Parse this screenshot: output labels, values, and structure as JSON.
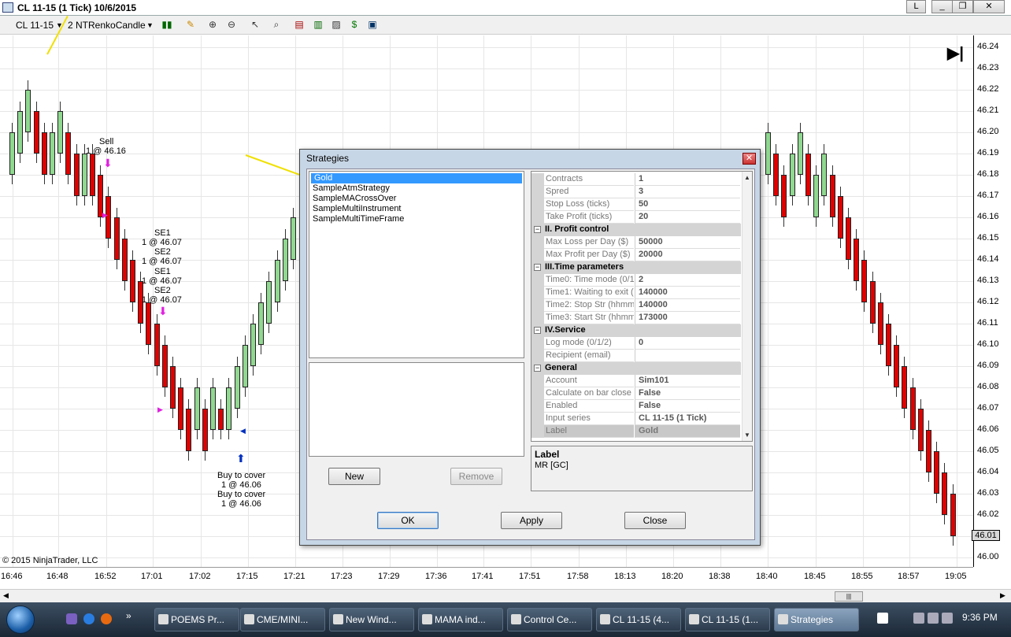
{
  "window": {
    "title": "CL 11-15 (1 Tick)  10/6/2015",
    "controls": [
      "L",
      "_",
      "❐",
      "✕"
    ]
  },
  "toolbar": {
    "instrument": "CL 11-15",
    "bar_type": "2 NTRenkoCandle"
  },
  "chart": {
    "price_ticks": [
      "46.24",
      "46.23",
      "46.22",
      "46.21",
      "46.20",
      "46.19",
      "46.18",
      "46.17",
      "46.16",
      "46.15",
      "46.14",
      "46.13",
      "46.12",
      "46.11",
      "46.10",
      "46.09",
      "46.08",
      "46.07",
      "46.06",
      "46.05",
      "46.04",
      "46.03",
      "46.02",
      "46.01",
      "46.00"
    ],
    "last_price": "46.01",
    "time_ticks": [
      "16:46",
      "16:48",
      "16:52",
      "17:01",
      "17:02",
      "17:15",
      "17:21",
      "17:23",
      "17:29",
      "17:36",
      "17:41",
      "17:51",
      "17:58",
      "18:13",
      "18:20",
      "18:38",
      "18:40",
      "18:45",
      "18:55",
      "18:57",
      "19:05"
    ],
    "copyright": "© 2015 NinjaTrader, LLC",
    "up_color": "#90d890",
    "down_color": "#e00000",
    "annotations": {
      "sell_1": "Sell",
      "sell_2": "1 @ 46.16",
      "se1_a": "SE1",
      "se1_a_qty": "1 @ 46.07",
      "se2_a": "SE2",
      "se2_a_qty": "1 @ 46.07",
      "se1_b": "SE1",
      "se1_b_qty": "1 @ 46.07",
      "se2_b": "SE2",
      "se2_b_qty": "1 @ 46.07",
      "btc_1": "Buy to cover",
      "btc_1_qty": "1 @ 46.06",
      "btc_2": "Buy to cover",
      "btc_2_qty": "1 @ 46.06"
    }
  },
  "dialog": {
    "title": "Strategies",
    "strategies": [
      "Gold",
      "SampleAtmStrategy",
      "SampleMACrossOver",
      "SampleMultiInstrument",
      "SampleMultiTimeFrame"
    ],
    "selected_strategy": "Gold",
    "buttons": {
      "new": "New",
      "remove": "Remove",
      "ok": "OK",
      "apply": "Apply",
      "close": "Close"
    },
    "properties": {
      "rows1": [
        {
          "name": "Contracts",
          "value": "1"
        },
        {
          "name": "Spred",
          "value": "3"
        },
        {
          "name": "Stop Loss (ticks)",
          "value": "50"
        },
        {
          "name": "Take Profit (ticks)",
          "value": "20"
        }
      ],
      "cat_profit": "II. Profit control",
      "rows2": [
        {
          "name": "Max Loss per Day  ($)",
          "value": "50000"
        },
        {
          "name": "Max Profit per Day ($)",
          "value": "20000"
        }
      ],
      "cat_time": "III.Time parameters",
      "rows3": [
        {
          "name": "Time0: Time mode (0/1/",
          "value": "2"
        },
        {
          "name": "Time1: Waiting to exit  (",
          "value": "140000"
        },
        {
          "name": "Time2: Stop Str (hhmms",
          "value": "140000"
        },
        {
          "name": "Time3: Start Str (hhmms",
          "value": "173000"
        }
      ],
      "cat_service": "IV.Service",
      "rows4": [
        {
          "name": "Log mode (0/1/2)",
          "value": "0"
        },
        {
          "name": "Recipient (email)",
          "value": ""
        }
      ],
      "cat_general": "General",
      "rows5": [
        {
          "name": "Account",
          "value": "Sim101"
        },
        {
          "name": "Calculate on bar close",
          "value": "False"
        },
        {
          "name": "Enabled",
          "value": "False"
        },
        {
          "name": "Input series",
          "value": "CL 11-15 (1 Tick)"
        },
        {
          "name": "Label",
          "value": "Gold"
        }
      ]
    },
    "help": {
      "label": "Label",
      "description": "MR [GC]"
    }
  },
  "taskbar": {
    "items": [
      "POEMS Pr...",
      "CME/MINI...",
      "New Wind...",
      "MAMA ind...",
      "Control Ce...",
      "CL 11-15 (4...",
      "CL 11-15 (1...",
      "Strategies"
    ],
    "active": "Strategies",
    "clock": "9:36 PM"
  }
}
